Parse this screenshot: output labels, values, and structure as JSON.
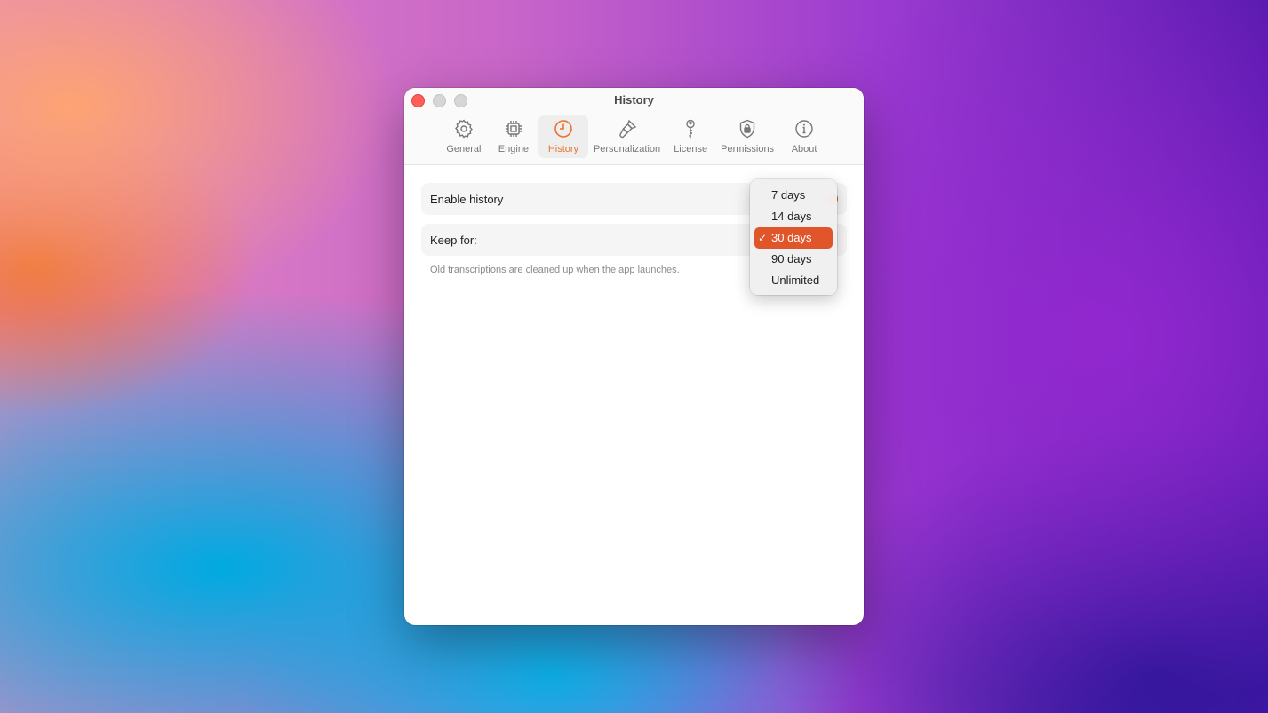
{
  "window": {
    "title": "History"
  },
  "toolbar": {
    "tabs": [
      {
        "label": "General",
        "icon": "gear-icon"
      },
      {
        "label": "Engine",
        "icon": "chip-icon"
      },
      {
        "label": "History",
        "icon": "clock-icon",
        "active": true
      },
      {
        "label": "Personalization",
        "icon": "brush-icon"
      },
      {
        "label": "License",
        "icon": "key-icon"
      },
      {
        "label": "Permissions",
        "icon": "lock-shield-icon"
      },
      {
        "label": "About",
        "icon": "info-icon"
      }
    ]
  },
  "settings": {
    "enable_history_label": "Enable history",
    "keep_for_label": "Keep for:",
    "hint": "Old transcriptions are cleaned up when the app launches."
  },
  "dropdown": {
    "options": [
      "7 days",
      "14 days",
      "30 days",
      "90 days",
      "Unlimited"
    ],
    "selected": "30 days",
    "check_mark": "✓"
  },
  "colors": {
    "accent": "#e8742e",
    "selection": "#e0562a",
    "close": "#ff5f57"
  }
}
